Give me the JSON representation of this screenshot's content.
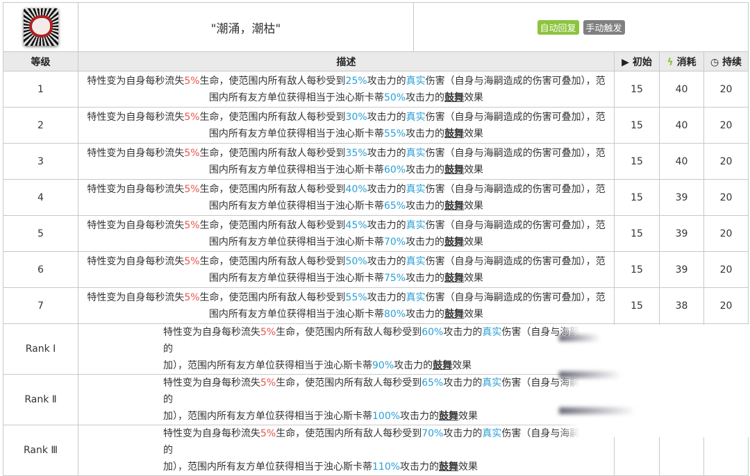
{
  "skill": {
    "title": "\"潮涌，潮枯\"",
    "tags": [
      {
        "label": "自动回复",
        "color": "#8cc43c"
      },
      {
        "label": "手动触发",
        "color": "#808080"
      }
    ]
  },
  "headers": {
    "level": "等级",
    "desc": "描述",
    "initial": "初始",
    "cost": "消耗",
    "duration": "持续"
  },
  "rows": [
    {
      "level": "1",
      "atk": "25%",
      "buff": "50%",
      "initial": "15",
      "cost": "40",
      "duration": "20"
    },
    {
      "level": "2",
      "atk": "30%",
      "buff": "55%",
      "initial": "15",
      "cost": "40",
      "duration": "20"
    },
    {
      "level": "3",
      "atk": "35%",
      "buff": "60%",
      "initial": "15",
      "cost": "40",
      "duration": "20"
    },
    {
      "level": "4",
      "atk": "40%",
      "buff": "65%",
      "initial": "15",
      "cost": "39",
      "duration": "20"
    },
    {
      "level": "5",
      "atk": "45%",
      "buff": "70%",
      "initial": "15",
      "cost": "39",
      "duration": "20"
    },
    {
      "level": "6",
      "atk": "50%",
      "buff": "75%",
      "initial": "15",
      "cost": "39",
      "duration": "20"
    },
    {
      "level": "7",
      "atk": "55%",
      "buff": "80%",
      "initial": "15",
      "cost": "38",
      "duration": "20"
    },
    {
      "level": "Rank Ⅰ",
      "atk": "60%",
      "buff": "90%",
      "initial": "",
      "cost": "",
      "duration": "",
      "obscured": true
    },
    {
      "level": "Rank Ⅱ",
      "atk": "65%",
      "buff": "100%",
      "initial": "",
      "cost": "",
      "duration": "",
      "obscured": true
    },
    {
      "level": "Rank Ⅲ",
      "atk": "70%",
      "buff": "110%",
      "initial": "",
      "cost": "",
      "duration": "",
      "obscured": true
    }
  ],
  "desc_parts": {
    "p1": "特性变为自身每秒流失",
    "hp": "5%",
    "p2": "生命，使范围内所有敌人每秒受到",
    "p3": "攻击力的",
    "true_dmg": "真实",
    "p4": "伤害（自身与海嗣造成的伤害可叠加），范围内所有友方单位获得相当于浊心斯卡蒂",
    "p4_short": "伤害（自身与海嗣造成的",
    "p4b": "加），范围内所有友方单位获得相当于浊心斯卡蒂",
    "p5": "攻击力的",
    "inspire": "鼓舞",
    "p6": "效果"
  }
}
